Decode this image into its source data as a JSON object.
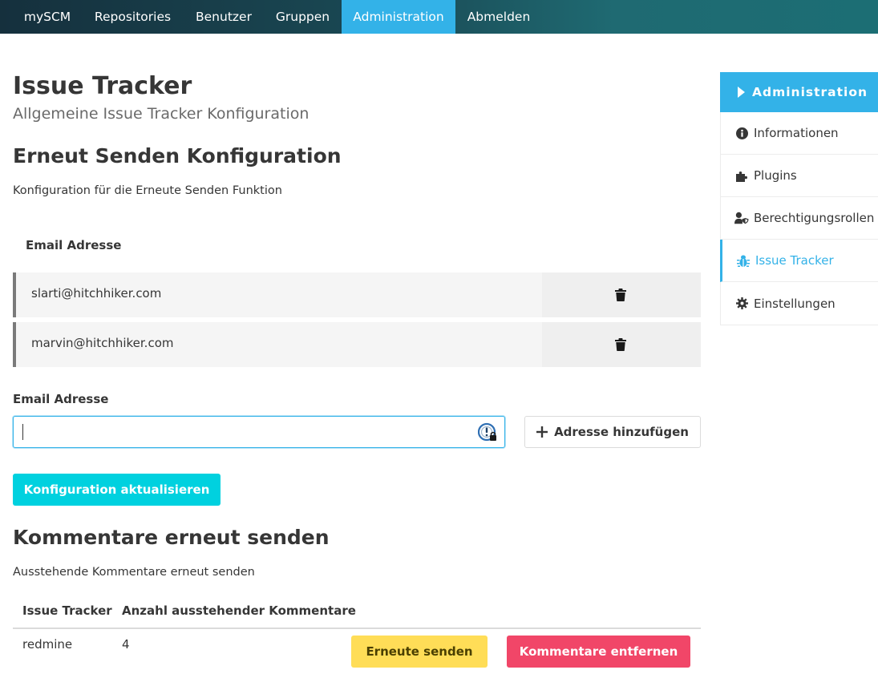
{
  "navbar": {
    "items": [
      {
        "label": "mySCM",
        "active": false
      },
      {
        "label": "Repositories",
        "active": false
      },
      {
        "label": "Benutzer",
        "active": false
      },
      {
        "label": "Gruppen",
        "active": false
      },
      {
        "label": "Administration",
        "active": true
      },
      {
        "label": "Abmelden",
        "active": false
      }
    ]
  },
  "page": {
    "title": "Issue Tracker",
    "subtitle": "Allgemeine Issue Tracker Konfiguration"
  },
  "resend_config": {
    "title": "Erneut Senden Konfiguration",
    "description": "Konfiguration für die Erneute Senden Funktion",
    "table_header": "Email Adresse",
    "emails": [
      "slarti@hitchhiker.com",
      "marvin@hitchhiker.com"
    ],
    "input_label": "Email Adresse",
    "input_value": "",
    "add_button": "Adresse hinzufügen",
    "update_button": "Konfiguration aktualisieren"
  },
  "resend_comments": {
    "title": "Kommentare erneut senden",
    "description": "Ausstehende Kommentare erneut senden",
    "columns": [
      "Issue Tracker",
      "Anzahl ausstehender Kommentare"
    ],
    "rows": [
      {
        "tracker": "redmine",
        "count": "4"
      }
    ],
    "resend_button": "Erneute senden",
    "remove_button": "Kommentare entfernen"
  },
  "sidebar": {
    "header": "Administration",
    "items": [
      {
        "label": "Informationen",
        "icon": "info-circle-icon",
        "active": false
      },
      {
        "label": "Plugins",
        "icon": "puzzle-icon",
        "active": false
      },
      {
        "label": "Berechtigungsrollen",
        "icon": "user-shield-icon",
        "active": false
      },
      {
        "label": "Issue Tracker",
        "icon": "bug-icon",
        "active": true
      },
      {
        "label": "Einstellungen",
        "icon": "gear-icon",
        "active": false
      }
    ]
  },
  "colors": {
    "primary": "#33b2e8",
    "success": "#00d1df",
    "warning": "#ffdd57",
    "danger": "#f14668"
  }
}
